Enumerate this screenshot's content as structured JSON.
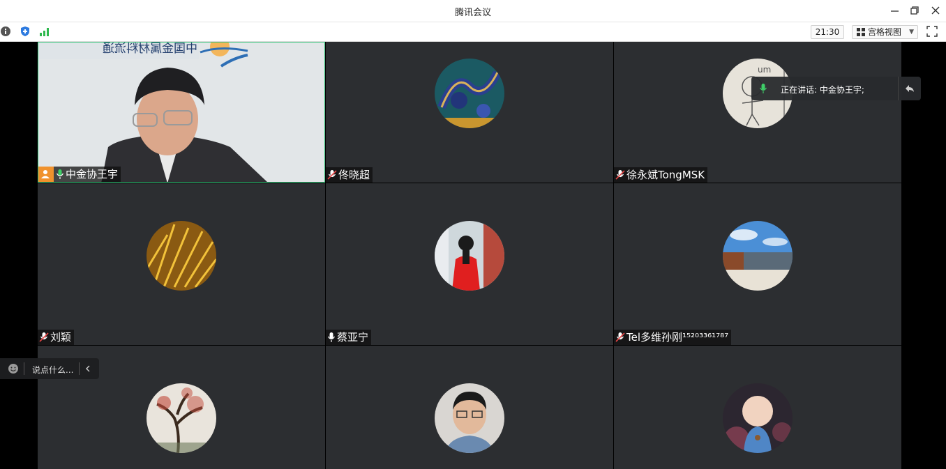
{
  "window": {
    "title": "腾讯会议"
  },
  "toolbar": {
    "clock": "21:30",
    "view_label": "宫格视图",
    "icons": [
      "info-icon",
      "shield-icon",
      "signal-icon"
    ]
  },
  "participants": [
    {
      "name": "中金协王宇",
      "mic": "on",
      "host": true
    },
    {
      "name": "佟晓超",
      "mic": "muted"
    },
    {
      "name": "徐永斌TongMSK",
      "mic": "muted"
    },
    {
      "name": "刘颖",
      "mic": "muted"
    },
    {
      "name": "蔡亚宁",
      "mic": "on-white"
    },
    {
      "name": "Tel多维孙刚¹⁵²⁰³³⁶¹⁷⁸⁷",
      "mic": "muted"
    },
    {
      "name": "",
      "mic": ""
    },
    {
      "name": "",
      "mic": ""
    },
    {
      "name": "",
      "mic": ""
    }
  ],
  "speaking": {
    "label": "正在讲话: 中金协王宇;"
  },
  "chat": {
    "placeholder": "说点什么..."
  },
  "colors": {
    "active_border": "#36c47a",
    "host_badge": "#f0922d",
    "tile_bg": "#2c2e31"
  }
}
